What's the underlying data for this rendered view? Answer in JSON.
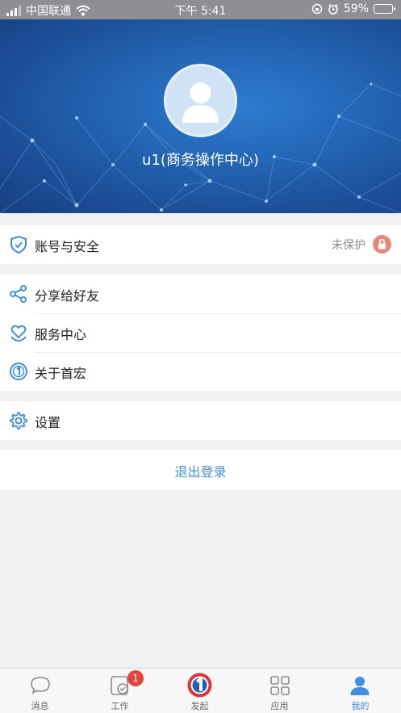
{
  "status_bar": {
    "carrier": "中国联通",
    "time": "下午 5:41",
    "battery": "59%",
    "battery_level": 0.59
  },
  "profile": {
    "username": "u1(商务操作中心)"
  },
  "menu": {
    "account_security": {
      "label": "账号与安全",
      "status": "未保护",
      "icon": "shield-icon"
    },
    "share": {
      "label": "分享给好友",
      "icon": "share-icon"
    },
    "service": {
      "label": "服务中心",
      "icon": "heart-hands-icon"
    },
    "about": {
      "label": "关于首宏",
      "icon": "logo-circle-icon"
    },
    "settings": {
      "label": "设置",
      "icon": "gear-icon"
    }
  },
  "logout_label": "退出登录",
  "tabbar": {
    "tabs": [
      {
        "label": "消息",
        "icon": "chat-bubble-icon"
      },
      {
        "label": "工作",
        "icon": "check-box-icon",
        "badge": "1"
      },
      {
        "label": "发起",
        "icon": "launch-logo-icon"
      },
      {
        "label": "应用",
        "icon": "grid-icon"
      },
      {
        "label": "我的",
        "icon": "person-icon",
        "active": true
      }
    ]
  },
  "colors": {
    "accent": "#3f8ee0",
    "badge": "#e0463c",
    "lock": "#e6877a",
    "banner": "#2467b6"
  }
}
